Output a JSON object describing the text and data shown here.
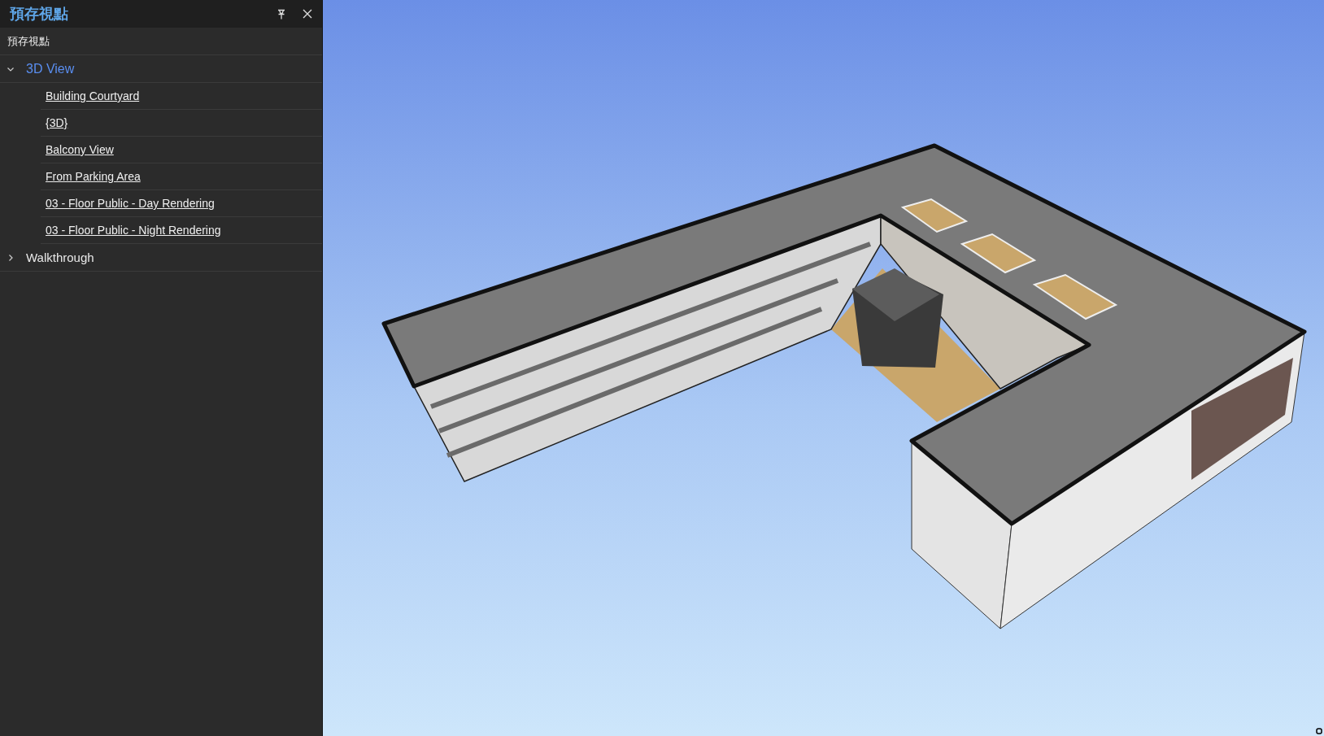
{
  "panel": {
    "title": "預存視點",
    "subtitle": "預存視點"
  },
  "tree": [
    {
      "label": "3D View",
      "selected": true,
      "expanded": true,
      "children": [
        {
          "label": "Building Courtyard"
        },
        {
          "label": "{3D}"
        },
        {
          "label": "Balcony View"
        },
        {
          "label": "From Parking Area"
        },
        {
          "label": "03 - Floor Public - Day Rendering"
        },
        {
          "label": "03 - Floor Public - Night Rendering"
        }
      ]
    },
    {
      "label": "Walkthrough",
      "selected": false,
      "expanded": false
    }
  ]
}
